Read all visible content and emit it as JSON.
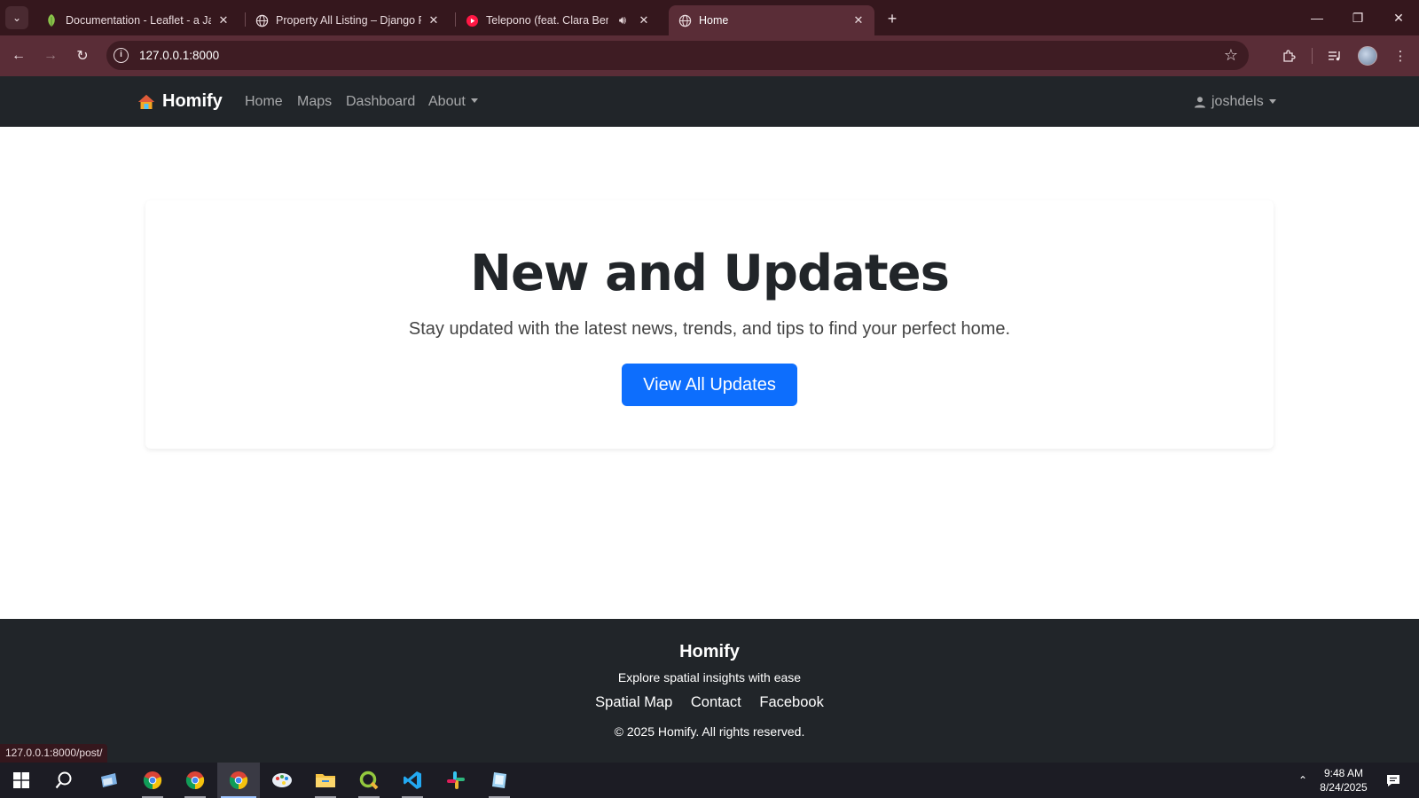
{
  "browser": {
    "tabs": [
      {
        "title": "Documentation - Leaflet - a JavaScript library"
      },
      {
        "title": "Property All Listing – Django REST framework"
      },
      {
        "title": "Telepono (feat. Clara Benin)"
      },
      {
        "title": "Home"
      }
    ],
    "url": "127.0.0.1:8000",
    "status_url": "127.0.0.1:8000/post/"
  },
  "site": {
    "brand": "Homify",
    "nav": [
      "Home",
      "Maps",
      "Dashboard",
      "About"
    ],
    "user": "joshdels"
  },
  "hero": {
    "title": "New and Updates",
    "subtitle": "Stay updated with the latest news, trends, and tips to find your perfect home.",
    "button": "View All Updates"
  },
  "footer": {
    "brand": "Homify",
    "tagline": "Explore spatial insights with ease",
    "links": [
      "Spatial Map",
      "Contact",
      "Facebook"
    ],
    "copyright": "© 2025 Homify. All rights reserved."
  },
  "taskbar": {
    "time": "9:48 AM",
    "date": "8/24/2025"
  },
  "colors": {
    "chrome_dark": "#35171d",
    "chrome_toolbar": "#5a2d37",
    "nav_bg": "#212529",
    "primary": "#0d6efd"
  }
}
